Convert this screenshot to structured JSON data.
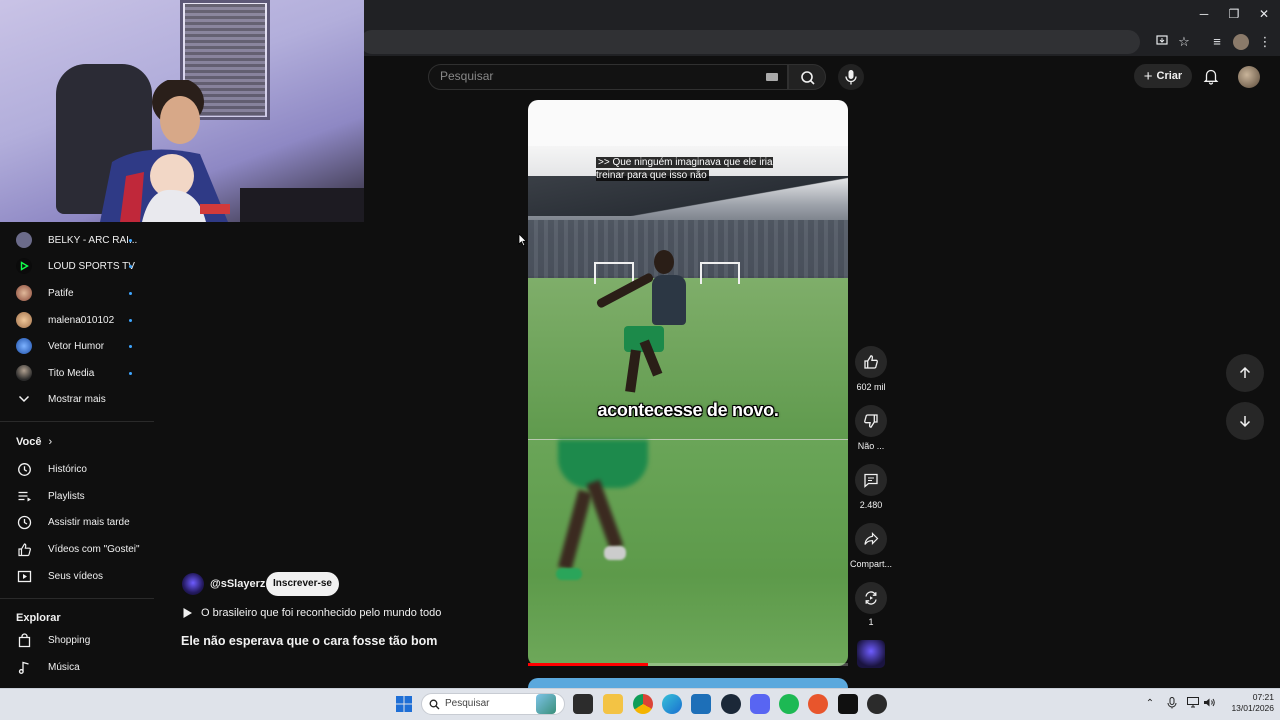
{
  "browser": {
    "minimize": "─",
    "maximize": "❐",
    "close": "✕"
  },
  "header": {
    "search_placeholder": "Pesquisar",
    "create_label": "Criar"
  },
  "sidebar": {
    "subscriptions": [
      {
        "label": "BELKY - ARC RAI...",
        "color": "#6b6b8a"
      },
      {
        "label": "LOUD SPORTS TV",
        "color": "#12ff4a"
      },
      {
        "label": "Patife",
        "color": "#b76b5a"
      },
      {
        "label": "malena010102",
        "color": "#c79a6a"
      },
      {
        "label": "Vetor Humor",
        "color": "#3a7bd5"
      },
      {
        "label": "Tito Media",
        "color": "#777777"
      }
    ],
    "show_more": "Mostrar mais",
    "you_section": "Você",
    "you_items": [
      {
        "label": "Histórico",
        "icon": "history-icon"
      },
      {
        "label": "Playlists",
        "icon": "playlists-icon"
      },
      {
        "label": "Assistir mais tarde",
        "icon": "watch-later-icon"
      },
      {
        "label": "Vídeos com \"Gostei\"",
        "icon": "liked-videos-icon"
      },
      {
        "label": "Seus vídeos",
        "icon": "your-videos-icon"
      }
    ],
    "explore_section": "Explorar",
    "explore_items": [
      {
        "label": "Shopping",
        "icon": "shopping-icon"
      },
      {
        "label": "Música",
        "icon": "music-icon"
      }
    ]
  },
  "short": {
    "cc_text": ">> Que ninguém imaginava que ele iria treinar para que isso não",
    "caption": "acontecesse de novo.",
    "progress": 0.375,
    "likes": "602 mil",
    "dislike_label": "Não ...",
    "comments": "2.480",
    "share_label": "Compart...",
    "remix_count": "1",
    "channel": "@sSlayerz",
    "subscribe_label": "Inscrever-se",
    "playlist_label": "O brasileiro que foi reconhecido pelo mundo todo",
    "title": "Ele não esperava que o cara fosse tão bom"
  },
  "taskbar": {
    "search_placeholder": "Pesquisar",
    "time": "07:21",
    "date": "13/01/2026"
  }
}
